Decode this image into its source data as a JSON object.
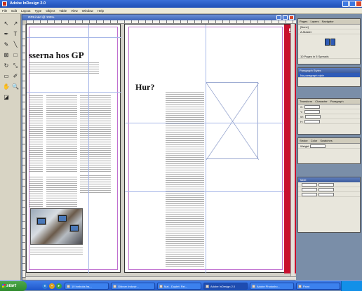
{
  "window": {
    "title": "Adobe InDesign 2.0"
  },
  "menu": [
    "File",
    "Edit",
    "Layout",
    "Type",
    "Object",
    "Table",
    "View",
    "Window",
    "Help"
  ],
  "document": {
    "title": "GP8.indd @ 100%",
    "headline": "sserna hos GP",
    "subheading": "Hur?",
    "page_number": "5"
  },
  "tools": [
    {
      "icon": "selection-arrow-icon",
      "glyph": "↖"
    },
    {
      "icon": "direct-selection-icon",
      "glyph": "↗"
    },
    {
      "icon": "pen-icon",
      "glyph": "✒"
    },
    {
      "icon": "type-icon",
      "glyph": "T"
    },
    {
      "icon": "pencil-icon",
      "glyph": "✎"
    },
    {
      "icon": "line-icon",
      "glyph": "╲"
    },
    {
      "icon": "rectangle-frame-icon",
      "glyph": "⊠"
    },
    {
      "icon": "rectangle-icon",
      "glyph": "□"
    },
    {
      "icon": "rotate-icon",
      "glyph": "↻"
    },
    {
      "icon": "scale-icon",
      "glyph": "⤡"
    },
    {
      "icon": "gradient-icon",
      "glyph": "▭"
    },
    {
      "icon": "eyedropper-icon",
      "glyph": "✐"
    },
    {
      "icon": "hand-icon",
      "glyph": "✋"
    },
    {
      "icon": "zoom-icon",
      "glyph": "🔍"
    },
    {
      "icon": "fill-stroke-icon",
      "glyph": "◪"
    }
  ],
  "panels": {
    "pages": {
      "tabs": [
        "Pages",
        "Layers",
        "Navigator"
      ],
      "items": [
        "[None]",
        "A-Master"
      ],
      "footer": "10 Pages in 5 Spreads"
    },
    "paragraph_styles": {
      "tabs": [
        "Paragraph Styles"
      ],
      "items": [
        "No paragraph style"
      ]
    },
    "transform": {
      "tabs": [
        "Transform",
        "Character",
        "Paragraph"
      ],
      "fields": [
        "X:",
        "Y:",
        "W:",
        "H:"
      ]
    },
    "stroke": {
      "tabs": [
        "Stroke",
        "Color",
        "Swatches"
      ],
      "fields": [
        "Weight"
      ]
    },
    "table": {
      "tabs": [
        "Table"
      ],
      "fields": []
    }
  },
  "taskbar": {
    "start_label": "start",
    "buttons": [
      "10 Innboks fra...",
      "Gidrarn Industr...",
      "Mal - Duplet: Rei...",
      "Adobe InDesign 2.0",
      "Adobe Photosho...",
      "Paint"
    ],
    "clock": ""
  },
  "colors": {
    "accent_red": "#c8102e",
    "xp_blue": "#1f56c9",
    "panel_head": "#3d5c9c"
  }
}
